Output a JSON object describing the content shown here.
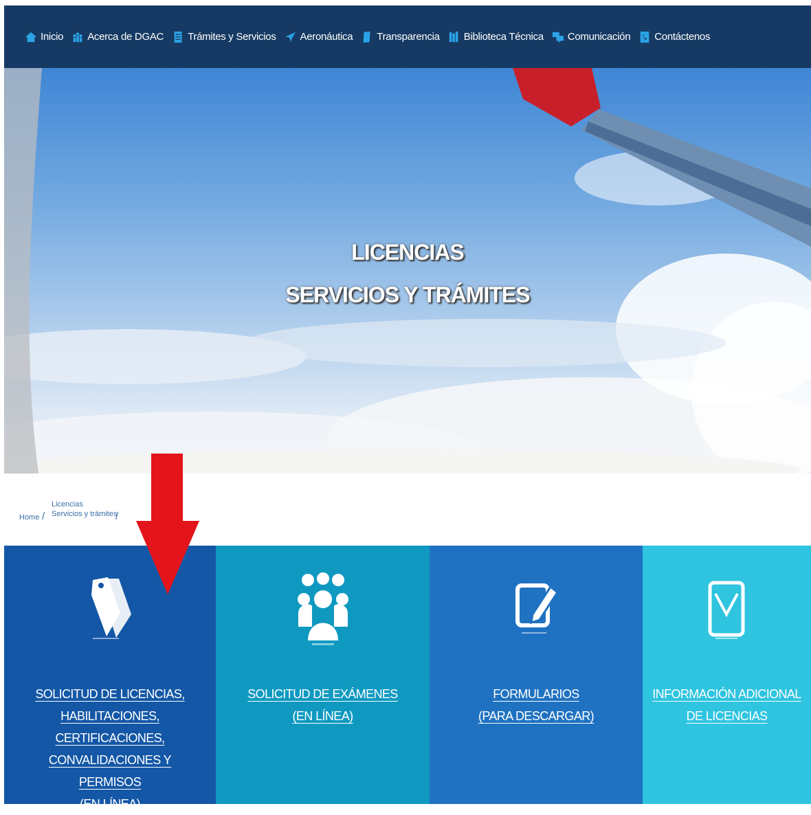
{
  "nav": {
    "items": [
      {
        "label": "Inicio",
        "icon": "home-icon"
      },
      {
        "label": "Acerca de DGAC",
        "icon": "people-icon"
      },
      {
        "label": "Trámites y Servicios",
        "icon": "document-icon"
      },
      {
        "label": "Aeronáutica",
        "icon": "airplane-icon"
      },
      {
        "label": "Transparencia",
        "icon": "folder-icon"
      },
      {
        "label": "Biblioteca Técnica",
        "icon": "books-icon"
      },
      {
        "label": "Comunicación",
        "icon": "chat-icon"
      },
      {
        "label": "Contáctenos",
        "icon": "phone-icon"
      }
    ]
  },
  "hero": {
    "title_line1": "LICENCIAS",
    "title_line2": "SERVICIOS Y TRÁMITES"
  },
  "breadcrumb": {
    "home": "Home",
    "current_line1": "Licencias",
    "current_line2": "Servicios y trámites"
  },
  "tiles": [
    {
      "icon": "tag-icon",
      "line1": "SOLICITUD DE LICENCIAS, HABILITACIONES,",
      "line2": "CERTIFICACIONES, CONVALIDACIONES Y",
      "line3": "PERMISOS",
      "line4": "(EN LÍNEA)"
    },
    {
      "icon": "users-icon",
      "line1": "SOLICITUD DE EXÁMENES",
      "line2": "(EN LÍNEA)"
    },
    {
      "icon": "edit-icon",
      "line1": "FORMULARIOS",
      "line2": "(PARA DESCARGAR)"
    },
    {
      "icon": "tablet-icon",
      "line1": "INFORMACIÓN ADICIONAL",
      "line2": "DE LICENCIAS"
    }
  ],
  "colors": {
    "nav_bg": "#163a63",
    "tile1": "#1457a6",
    "tile2": "#0f99c0",
    "tile3": "#1f72c1",
    "tile4": "#2fc4e0",
    "arrow": "#e3151b",
    "icon_accent": "#2aa3e6"
  }
}
